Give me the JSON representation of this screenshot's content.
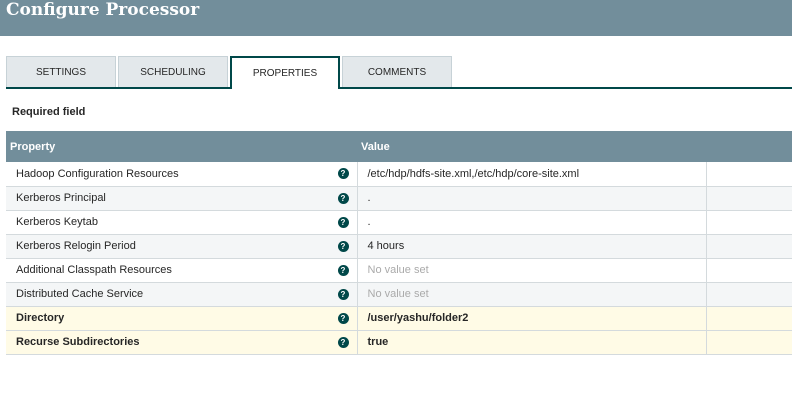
{
  "title": "Configure Processor",
  "tabs": [
    {
      "label": "SETTINGS"
    },
    {
      "label": "SCHEDULING"
    },
    {
      "label": "PROPERTIES",
      "active": true
    },
    {
      "label": "COMMENTS"
    }
  ],
  "required_label": "Required field",
  "table": {
    "headers": {
      "property": "Property",
      "value": "Value"
    },
    "rows": [
      {
        "property": "Hadoop Configuration Resources",
        "value": "/etc/hdp/hdfs-site.xml,/etc/hdp/core-site.xml"
      },
      {
        "property": "Kerberos Principal",
        "value": "."
      },
      {
        "property": "Kerberos Keytab",
        "value": "."
      },
      {
        "property": "Kerberos Relogin Period",
        "value": "4 hours"
      },
      {
        "property": "Additional Classpath Resources",
        "value": "No value set"
      },
      {
        "property": "Distributed Cache Service",
        "value": "No value set"
      },
      {
        "property": "Directory",
        "value": "/user/yashu/folder2"
      },
      {
        "property": "Recurse Subdirectories",
        "value": "true"
      }
    ]
  },
  "colors": {
    "header": "#728e9b",
    "accent": "#004849",
    "required_row": "#fffbe6"
  }
}
